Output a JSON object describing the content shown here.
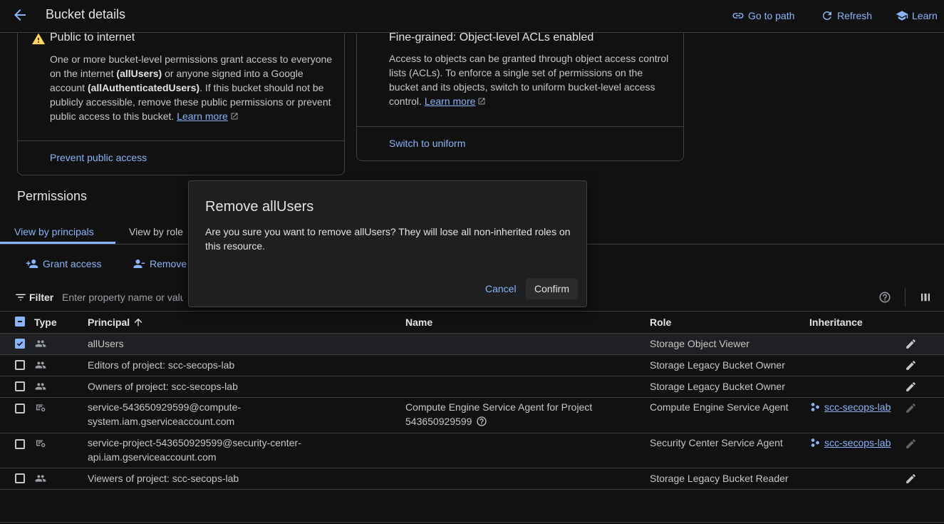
{
  "header": {
    "title": "Bucket details",
    "go_to_path": "Go to path",
    "refresh": "Refresh",
    "learn": "Learn"
  },
  "public_card": {
    "title": "Public to internet",
    "body_1": "One or more bucket-level permissions grant access to everyone on the internet ",
    "body_all_users": "(allUsers)",
    "body_2": " or anyone signed into a Google account ",
    "body_all_auth": "(allAuthenticatedUsers)",
    "body_3": ". If this bucket should not be publicly accessible, remove these public permissions or prevent public access to this bucket. ",
    "learn_more": "Learn more",
    "action": "Prevent public access"
  },
  "acl_card": {
    "title": "Fine-grained: Object-level ACLs enabled",
    "body": "Access to objects can be granted through object access control lists (ACLs). To enforce a single set of permissions on the bucket and its objects, switch to uniform bucket-level access control. ",
    "learn_more": "Learn more",
    "action": "Switch to uniform"
  },
  "permissions": {
    "title": "Permissions",
    "tabs": [
      "View by principals",
      "View by role"
    ],
    "grant_access": "Grant access",
    "remove": "Remove",
    "filter_label": "Filter",
    "filter_placeholder": "Enter property name or value"
  },
  "table": {
    "headers": {
      "type": "Type",
      "principal": "Principal",
      "name": "Name",
      "role": "Role",
      "inheritance": "Inheritance"
    },
    "rows": [
      {
        "principal": "allUsers",
        "name": "",
        "role": "Storage Object Viewer",
        "inheritance": "",
        "checked": true
      },
      {
        "principal": "Editors of project: scc-secops-lab",
        "name": "",
        "role": "Storage Legacy Bucket Owner",
        "inheritance": ""
      },
      {
        "principal": "Owners of project: scc-secops-lab",
        "name": "",
        "role": "Storage Legacy Bucket Owner",
        "inheritance": ""
      },
      {
        "principal_1": "service-543650929599@compute-",
        "principal_2": "system.iam.gserviceaccount.com",
        "name_1": "Compute Engine Service Agent for Project",
        "name_2": "543650929599",
        "role": "Compute Engine Service Agent",
        "inheritance": "scc-secops-lab"
      },
      {
        "principal_1": "service-project-543650929599@security-center-",
        "principal_2": "api.iam.gserviceaccount.com",
        "name": "",
        "role": "Security Center Service Agent",
        "inheritance": "scc-secops-lab"
      },
      {
        "principal": "Viewers of project: scc-secops-lab",
        "name": "",
        "role": "Storage Legacy Bucket Reader",
        "inheritance": ""
      }
    ]
  },
  "dialog": {
    "title": "Remove allUsers",
    "message": "Are you sure you want to remove allUsers? They will lose all non-inherited roles on this resource.",
    "cancel": "Cancel",
    "confirm": "Confirm"
  },
  "colors": {
    "background": "#111112",
    "accent": "#8ab4f8",
    "warning": "#fdd663",
    "border": "#3c4043",
    "dialog": "#1e1f20"
  }
}
